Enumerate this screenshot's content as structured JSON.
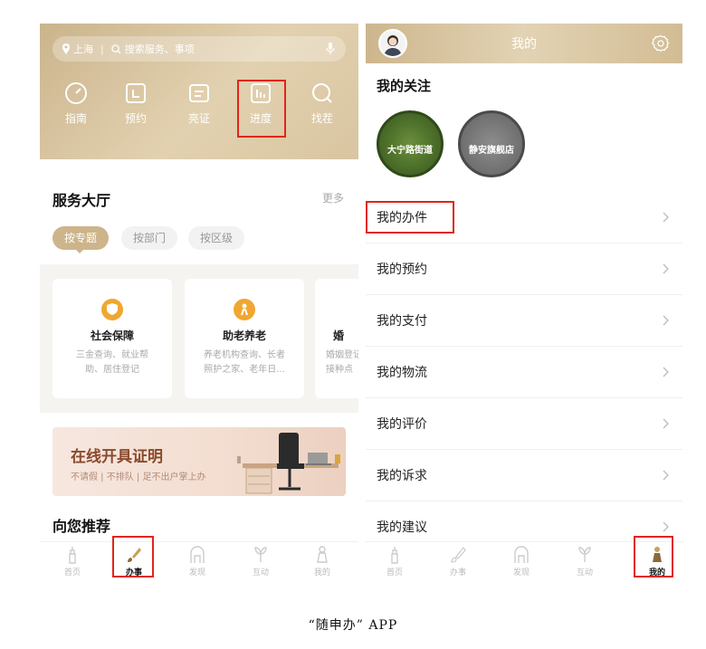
{
  "left": {
    "search": {
      "location": "上海",
      "placeholder": "搜索服务、事项"
    },
    "quick_actions": [
      {
        "label": "指南",
        "icon": "gauge-icon"
      },
      {
        "label": "预约",
        "icon": "calendar-icon"
      },
      {
        "label": "亮证",
        "icon": "card-icon"
      },
      {
        "label": "进度",
        "icon": "progress-chart-icon"
      },
      {
        "label": "找茬",
        "icon": "search-icon"
      }
    ],
    "service_hall": {
      "title": "服务大厅",
      "more": "更多"
    },
    "chips": [
      "按专题",
      "按部门",
      "按区级"
    ],
    "cards": [
      {
        "title": "社会保障",
        "desc_line1": "三金查询、就业帮",
        "desc_line2": "助、居住登记"
      },
      {
        "title": "助老养老",
        "desc_line1": "养老机构查询、长者",
        "desc_line2": "照护之家、老年日..."
      },
      {
        "title": "婚",
        "desc_line1": "婚姻登记",
        "desc_line2": "接种点"
      }
    ],
    "banner": {
      "title": "在线开具证明",
      "subtitle": "不请假 | 不排队 | 足不出户掌上办"
    },
    "recommend_title": "向您推荐",
    "tabs": [
      "首页",
      "办事",
      "发现",
      "互动",
      "我的"
    ]
  },
  "right": {
    "header_title": "我的",
    "follow_title": "我的关注",
    "follows": [
      "大宁路街道",
      "静安旗舰店"
    ],
    "menu": [
      "我的办件",
      "我的预约",
      "我的支付",
      "我的物流",
      "我的评价",
      "我的诉求",
      "我的建议"
    ],
    "tabs": [
      "首页",
      "办事",
      "发现",
      "互动",
      "我的"
    ]
  },
  "caption": "“随申办” APP",
  "colors": {
    "gold": "#cdb48a",
    "highlight_red": "#e1251b",
    "banner_text": "#8b4a2b"
  }
}
